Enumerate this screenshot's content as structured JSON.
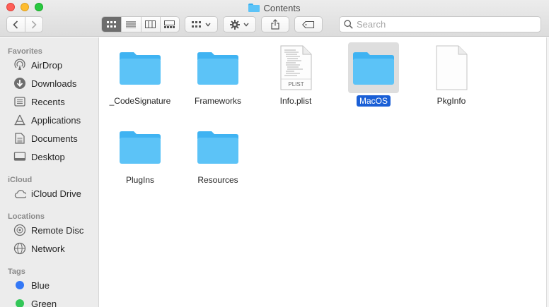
{
  "window": {
    "title": "Contents"
  },
  "toolbar": {
    "back_icon": "chevron-left-icon",
    "forward_icon": "chevron-right-icon",
    "view_modes": [
      "icon-view",
      "list-view",
      "column-view",
      "gallery-view"
    ],
    "active_view": "icon-view",
    "search_placeholder": "Search"
  },
  "sidebar": {
    "sections": [
      {
        "title": "Favorites",
        "items": [
          {
            "label": "AirDrop",
            "icon": "airdrop-icon"
          },
          {
            "label": "Downloads",
            "icon": "downloads-icon"
          },
          {
            "label": "Recents",
            "icon": "recents-icon"
          },
          {
            "label": "Applications",
            "icon": "applications-icon"
          },
          {
            "label": "Documents",
            "icon": "documents-icon"
          },
          {
            "label": "Desktop",
            "icon": "desktop-icon"
          }
        ]
      },
      {
        "title": "iCloud",
        "items": [
          {
            "label": "iCloud Drive",
            "icon": "cloud-icon"
          }
        ]
      },
      {
        "title": "Locations",
        "items": [
          {
            "label": "Remote Disc",
            "icon": "disc-icon"
          },
          {
            "label": "Network",
            "icon": "network-icon"
          }
        ]
      },
      {
        "title": "Tags",
        "items": [
          {
            "label": "Blue",
            "icon": "tag-dot-icon",
            "color": "#3478f6"
          },
          {
            "label": "Green",
            "icon": "tag-dot-icon",
            "color": "#34c759"
          }
        ]
      }
    ]
  },
  "files": [
    {
      "name": "_CodeSignature",
      "kind": "folder",
      "selected": false
    },
    {
      "name": "Frameworks",
      "kind": "folder",
      "selected": false
    },
    {
      "name": "Info.plist",
      "kind": "plist",
      "badge": "PLIST",
      "selected": false
    },
    {
      "name": "MacOS",
      "kind": "folder",
      "selected": true
    },
    {
      "name": "PkgInfo",
      "kind": "document",
      "selected": false
    },
    {
      "name": "PlugIns",
      "kind": "folder",
      "selected": false
    },
    {
      "name": "Resources",
      "kind": "folder",
      "selected": false
    }
  ],
  "colors": {
    "folder": "#5cc3f7",
    "folder_tab": "#3fb3f2",
    "selection": "#1a5fd6",
    "sidebar_bg": "#ececec"
  }
}
